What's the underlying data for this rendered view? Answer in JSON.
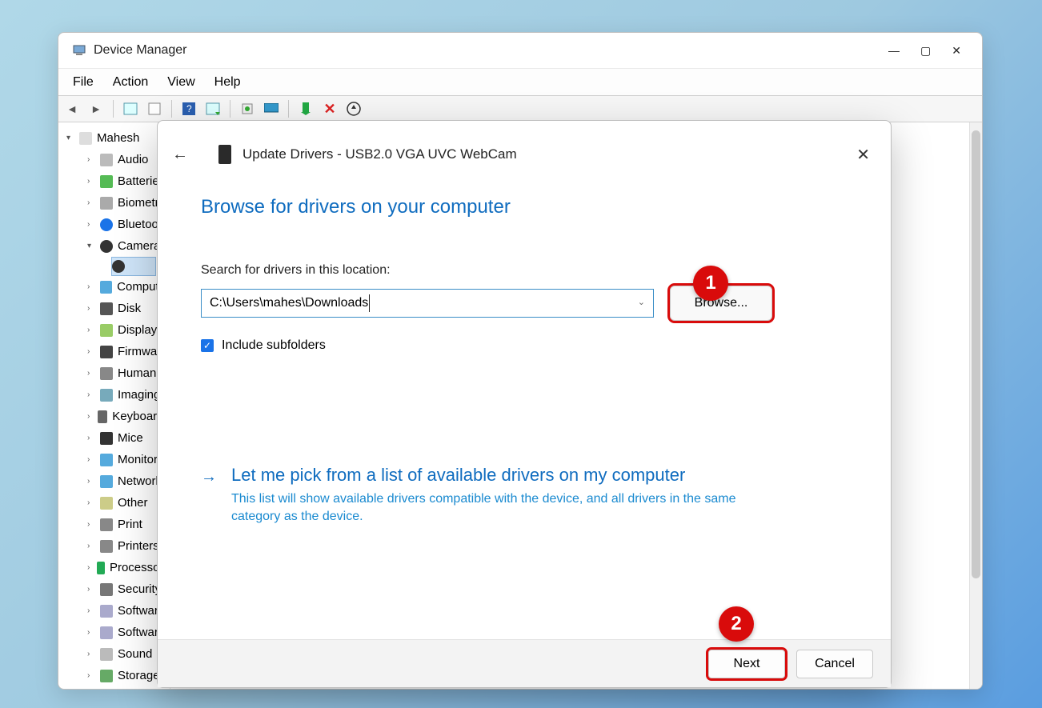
{
  "window": {
    "title": "Device Manager",
    "menu": {
      "file": "File",
      "action": "Action",
      "view": "View",
      "help": "Help"
    }
  },
  "tree": {
    "root": "Mahesh",
    "items": [
      "Audio",
      "Batteries",
      "Biometric",
      "Bluetooth",
      "Cameras",
      "Computer",
      "Disk",
      "Display",
      "Firmware",
      "Human",
      "Imaging",
      "Keyboards",
      "Mice",
      "Monitors",
      "Network",
      "Other",
      "Print",
      "Printers",
      "Processors",
      "Security",
      "Software",
      "Software",
      "Sound",
      "Storage"
    ]
  },
  "dialog": {
    "title": "Update Drivers - USB2.0 VGA UVC WebCam",
    "heading": "Browse for drivers on your computer",
    "path_label": "Search for drivers in this location:",
    "path_value": "C:\\Users\\mahes\\Downloads",
    "browse_label": "Browse...",
    "include_subfolders": "Include subfolders",
    "option2_title": "Let me pick from a list of available drivers on my computer",
    "option2_desc": "This list will show available drivers compatible with the device, and all drivers in the same category as the device.",
    "next_label": "Next",
    "cancel_label": "Cancel"
  },
  "annotations": {
    "badge1": "1",
    "badge2": "2"
  }
}
